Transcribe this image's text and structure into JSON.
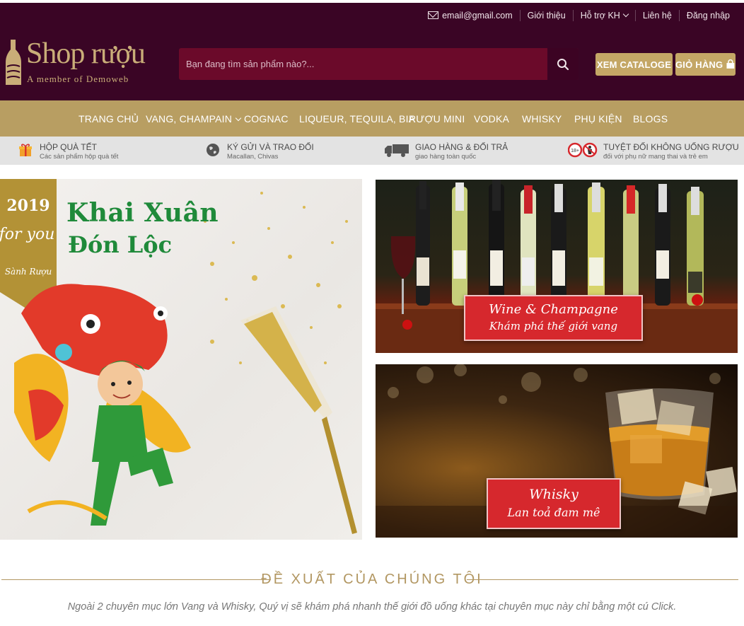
{
  "topbar": {
    "email": "email@gmail.com",
    "links": [
      "Giới thiệu",
      "Hỗ trợ KH",
      "Liên hệ",
      "Đăng nhập"
    ]
  },
  "logo": {
    "brand": "Shop rượu",
    "tagline": "A member of Demoweb"
  },
  "search": {
    "placeholder": "Bạn đang tìm sản phẩm nào?..."
  },
  "buttons": {
    "catalogue": "XEM CATALOGE",
    "cart": "GIỎ HÀNG"
  },
  "nav": [
    "TRANG CHỦ",
    "VANG, CHAMPAIN",
    "COGNAC",
    "LIQUEUR, TEQUILA, BIA",
    "RƯỢU MINI",
    "VODKA",
    "WHISKY",
    "PHỤ KIỆN",
    "BLOGS"
  ],
  "features": [
    {
      "title": "HỘP QUÀ TẾT",
      "subtitle": "Các sản phẩm hộp quà tết",
      "icon": "gift-icon"
    },
    {
      "title": "KÝ GỬI VÀ TRAO ĐỔI",
      "subtitle": "Macallan, Chivas",
      "icon": "globe-icon"
    },
    {
      "title": "GIAO HÀNG & ĐỔI TRẢ",
      "subtitle": "giao hàng toàn quốc",
      "icon": "truck-icon"
    },
    {
      "title": "TUYỆT ĐỐI KHÔNG UỐNG RƯỢU",
      "subtitle": "đối với phụ nữ mang thai và trẻ em",
      "icon": "no-alcohol-icon"
    }
  ],
  "banners": {
    "left": {
      "year": "2019",
      "for_you": "for you",
      "sign": "Sành Rượu",
      "title1": "Khai Xuân",
      "title2": "Đón Lộc"
    },
    "wine": {
      "line1": "Wine & Champagne",
      "line2": "Khám phá thế giới vang"
    },
    "whisky": {
      "line1": "Whisky",
      "line2": "Lan toả đam mê"
    }
  },
  "section": {
    "title": "ĐỀ XUẤT CỦA CHÚNG TÔI",
    "description": "Ngoài 2 chuyên mục lớn Vang và Whisky, Quý vị sẽ khám phá nhanh thế giới đồ uống khác tại chuyên mục này chỉ bằng một cú Click."
  },
  "colors": {
    "header_bg": "#3a0525",
    "nav_gold": "#b89e62",
    "button_gold": "#c4a766",
    "accent_red": "#d6282d"
  }
}
